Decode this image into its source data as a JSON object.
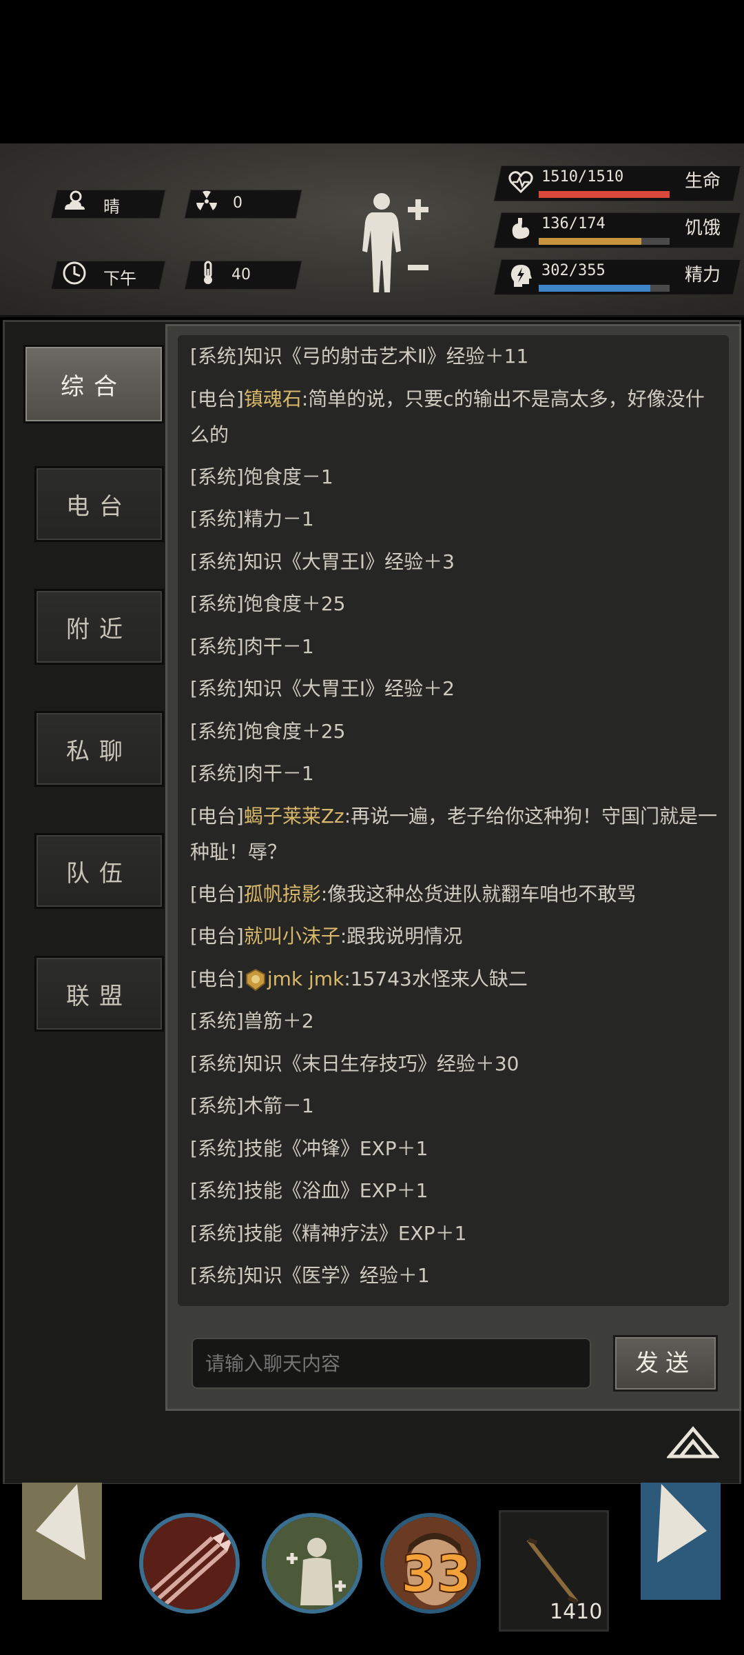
{
  "status": {
    "weather": {
      "icon": "sun-cloud-icon",
      "label": "晴"
    },
    "radiation": {
      "icon": "radiation-icon",
      "value": "0"
    },
    "time_of_day": {
      "icon": "clock-icon",
      "label": "下午"
    },
    "temperature": {
      "icon": "thermometer-icon",
      "value": "40"
    },
    "body_icon": "body-figure-icon",
    "bars": [
      {
        "key": "health",
        "icon": "heart-pulse-icon",
        "value": "1510/1510",
        "label": "生命",
        "fraction": 1.0,
        "color": "#d9483b"
      },
      {
        "key": "hunger",
        "icon": "stomach-icon",
        "value": "136/174",
        "label": "饥饿",
        "fraction": 0.782,
        "color": "#c9943e"
      },
      {
        "key": "energy",
        "icon": "head-bolt-icon",
        "value": "302/355",
        "label": "精力",
        "fraction": 0.851,
        "color": "#3f86c8"
      }
    ]
  },
  "tabs": [
    {
      "label": "综合",
      "active": true
    },
    {
      "label": "电台",
      "active": false
    },
    {
      "label": "附近",
      "active": false
    },
    {
      "label": "私聊",
      "active": false
    },
    {
      "label": "队伍",
      "active": false
    },
    {
      "label": "联盟",
      "active": false
    }
  ],
  "chat": {
    "messages": [
      {
        "tag": "[系统]",
        "text": "知识《弓的射击艺术Ⅱ》经验＋11"
      },
      {
        "tag": "[电台]",
        "user": "镇魂石",
        "text": ":简单的说，只要c的输出不是高太多，好像没什么的",
        "wrap": true
      },
      {
        "tag": "[系统]",
        "text": "饱食度－1"
      },
      {
        "tag": "[系统]",
        "text": "精力－1"
      },
      {
        "tag": "[系统]",
        "text": "知识《大胃王Ⅰ》经验＋3"
      },
      {
        "tag": "[系统]",
        "text": "饱食度＋25"
      },
      {
        "tag": "[系统]",
        "text": "肉干－1"
      },
      {
        "tag": "[系统]",
        "text": "知识《大胃王Ⅰ》经验＋2"
      },
      {
        "tag": "[系统]",
        "text": "饱食度＋25"
      },
      {
        "tag": "[系统]",
        "text": "肉干－1"
      },
      {
        "tag": "[电台]",
        "user": "蝎子莱莱Zz",
        "text": ":再说一遍，老子给你这种狗！守国门就是一种耻！辱？",
        "wrap": true
      },
      {
        "tag": "[电台]",
        "user": "孤帆掠影",
        "text": ":像我这种怂货进队就翻车咱也不敢骂"
      },
      {
        "tag": "[电台]",
        "user": "就叫小沫子",
        "text": ":跟我说明情况"
      },
      {
        "tag": "[电台]",
        "badge": "guild-badge-icon",
        "user": "jmk jmk",
        "text": ":15743水怪来人缺二"
      },
      {
        "tag": "[系统]",
        "text": "兽筋＋2"
      },
      {
        "tag": "[系统]",
        "text": "知识《末日生存技巧》经验＋30"
      },
      {
        "tag": "[系统]",
        "text": "木箭－1"
      },
      {
        "tag": "[系统]",
        "text": "技能《冲锋》EXP＋1"
      },
      {
        "tag": "[系统]",
        "text": "技能《浴血》EXP＋1"
      },
      {
        "tag": "[系统]",
        "text": "技能《精神疗法》EXP＋1"
      },
      {
        "tag": "[系统]",
        "text": "知识《医学》经验＋1"
      }
    ],
    "input_placeholder": "请输入聊天内容",
    "send_label": "发送"
  },
  "hotbar": {
    "skills": [
      {
        "icon": "arrow-volley-skill-icon"
      },
      {
        "icon": "heal-figure-skill-icon"
      },
      {
        "icon": "character-portrait-icon",
        "level": "33"
      }
    ],
    "item": {
      "icon": "crossbow-item-icon",
      "count": "1410"
    }
  }
}
